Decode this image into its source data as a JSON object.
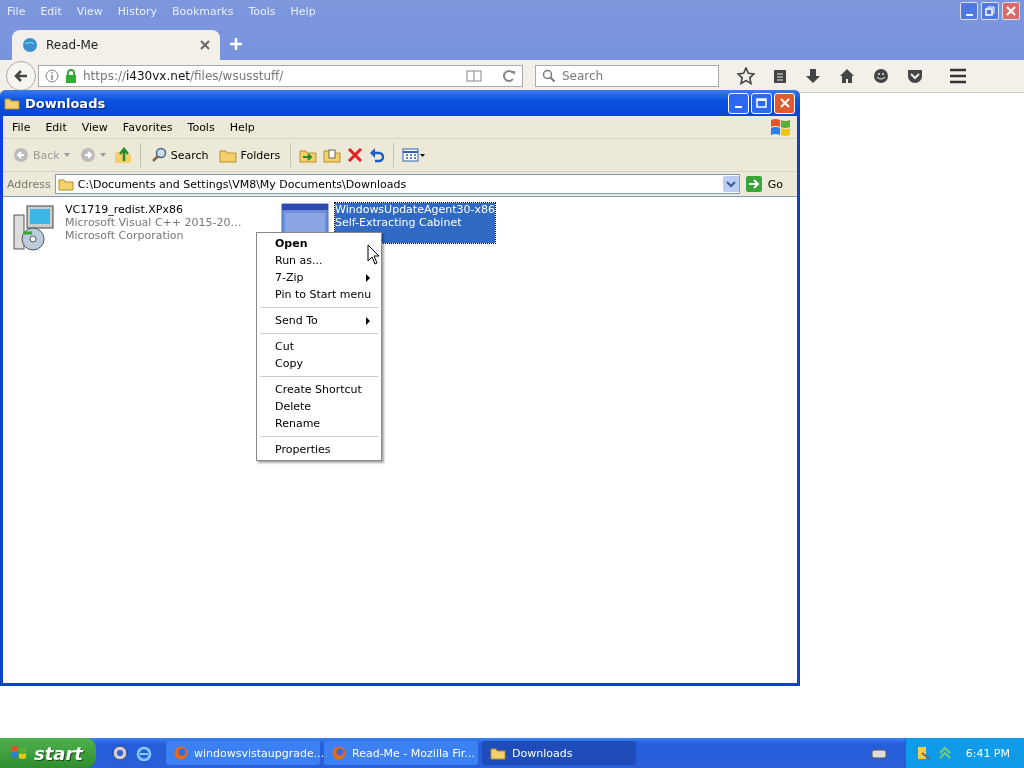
{
  "browser": {
    "menu": [
      "File",
      "Edit",
      "View",
      "History",
      "Bookmarks",
      "Tools",
      "Help"
    ],
    "tab": {
      "title": "Read-Me",
      "selected": true
    },
    "url": {
      "scheme": "https://",
      "host": "i430vx.net",
      "path": "/files/wsusstuff/"
    },
    "search": {
      "placeholder": "Search"
    }
  },
  "explorer": {
    "title": "Downloads",
    "menu": [
      "File",
      "Edit",
      "View",
      "Favorites",
      "Tools",
      "Help"
    ],
    "toolbar": [
      {
        "kind": "back",
        "label": "Back",
        "disabled": true
      },
      {
        "kind": "forward",
        "disabled": true
      },
      {
        "kind": "up"
      },
      {
        "kind": "search",
        "label": "Search"
      },
      {
        "kind": "folders",
        "label": "Folders"
      },
      {
        "kind": "move"
      },
      {
        "kind": "copy"
      },
      {
        "kind": "delete"
      },
      {
        "kind": "undo"
      },
      {
        "kind": "views"
      }
    ],
    "address": {
      "label": "Address",
      "path": "C:\\Documents and Settings\\VM8\\My Documents\\Downloads",
      "go": "Go"
    },
    "files": [
      {
        "kind": "installer",
        "lines": [
          "VC1719_redist.XPx86",
          "Microsoft Visual C++ 2015-20…",
          "Microsoft Corporation"
        ],
        "selected": false
      },
      {
        "kind": "window",
        "lines": [
          "WindowsUpdateAgent30-x86",
          "Self-Extracting Cabinet"
        ],
        "selected": true
      }
    ]
  },
  "context_menu": [
    {
      "kind": "item",
      "label": "Open",
      "default": true,
      "submenu": false
    },
    {
      "kind": "item",
      "label": "Run as...",
      "default": false,
      "submenu": false
    },
    {
      "kind": "item",
      "label": "7-Zip",
      "default": false,
      "submenu": true
    },
    {
      "kind": "item",
      "label": "Pin to Start menu",
      "default": false,
      "submenu": false
    },
    {
      "kind": "separator"
    },
    {
      "kind": "item",
      "label": "Send To",
      "default": false,
      "submenu": true
    },
    {
      "kind": "separator"
    },
    {
      "kind": "item",
      "label": "Cut",
      "default": false,
      "submenu": false
    },
    {
      "kind": "item",
      "label": "Copy",
      "default": false,
      "submenu": false
    },
    {
      "kind": "separator"
    },
    {
      "kind": "item",
      "label": "Create Shortcut",
      "default": false,
      "submenu": false
    },
    {
      "kind": "item",
      "label": "Delete",
      "default": false,
      "submenu": false
    },
    {
      "kind": "item",
      "label": "Rename",
      "default": false,
      "submenu": false
    },
    {
      "kind": "separator"
    },
    {
      "kind": "item",
      "label": "Properties",
      "default": false,
      "submenu": false
    }
  ],
  "taskbar": {
    "start": "start",
    "tasks": [
      {
        "kind": "firefox",
        "label": "windowsvistaupgrade...",
        "selected": false
      },
      {
        "kind": "firefox",
        "label": "Read-Me - Mozilla Fir...",
        "selected": false
      },
      {
        "kind": "folder",
        "label": "Downloads",
        "selected": true
      }
    ],
    "clock": "6:41 PM"
  }
}
